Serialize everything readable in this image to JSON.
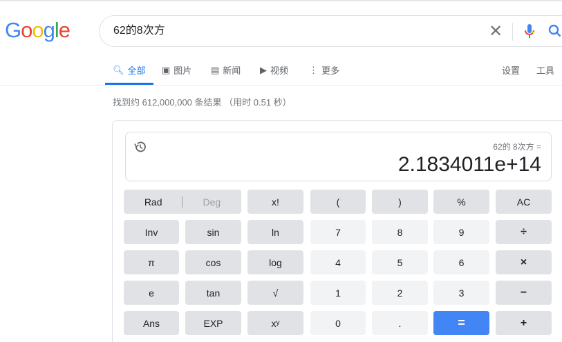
{
  "logo": "Google",
  "search": {
    "value": "62的8次方"
  },
  "tabs": [
    {
      "label": "全部"
    },
    {
      "label": "图片"
    },
    {
      "label": "新闻"
    },
    {
      "label": "视频"
    },
    {
      "label": "更多"
    }
  ],
  "tools": {
    "settings": "设置",
    "tools": "工具"
  },
  "stats": "找到约 612,000,000 条结果 （用时 0.51 秒）",
  "calc": {
    "expression": "62的 8次方 =",
    "result": "2.1834011e+14",
    "rad": "Rad",
    "deg": "Deg",
    "buttons": [
      "x!",
      "(",
      ")",
      "%",
      "AC",
      "Inv",
      "sin",
      "ln",
      "7",
      "8",
      "9",
      "÷",
      "π",
      "cos",
      "log",
      "4",
      "5",
      "6",
      "×",
      "e",
      "tan",
      "√",
      "1",
      "2",
      "3",
      "−",
      "Ans",
      "EXP",
      "x",
      "0",
      ".",
      "=",
      "+"
    ],
    "sup": "y"
  },
  "colors": {
    "accent": "#1a73e8",
    "equals": "#4285f4"
  }
}
